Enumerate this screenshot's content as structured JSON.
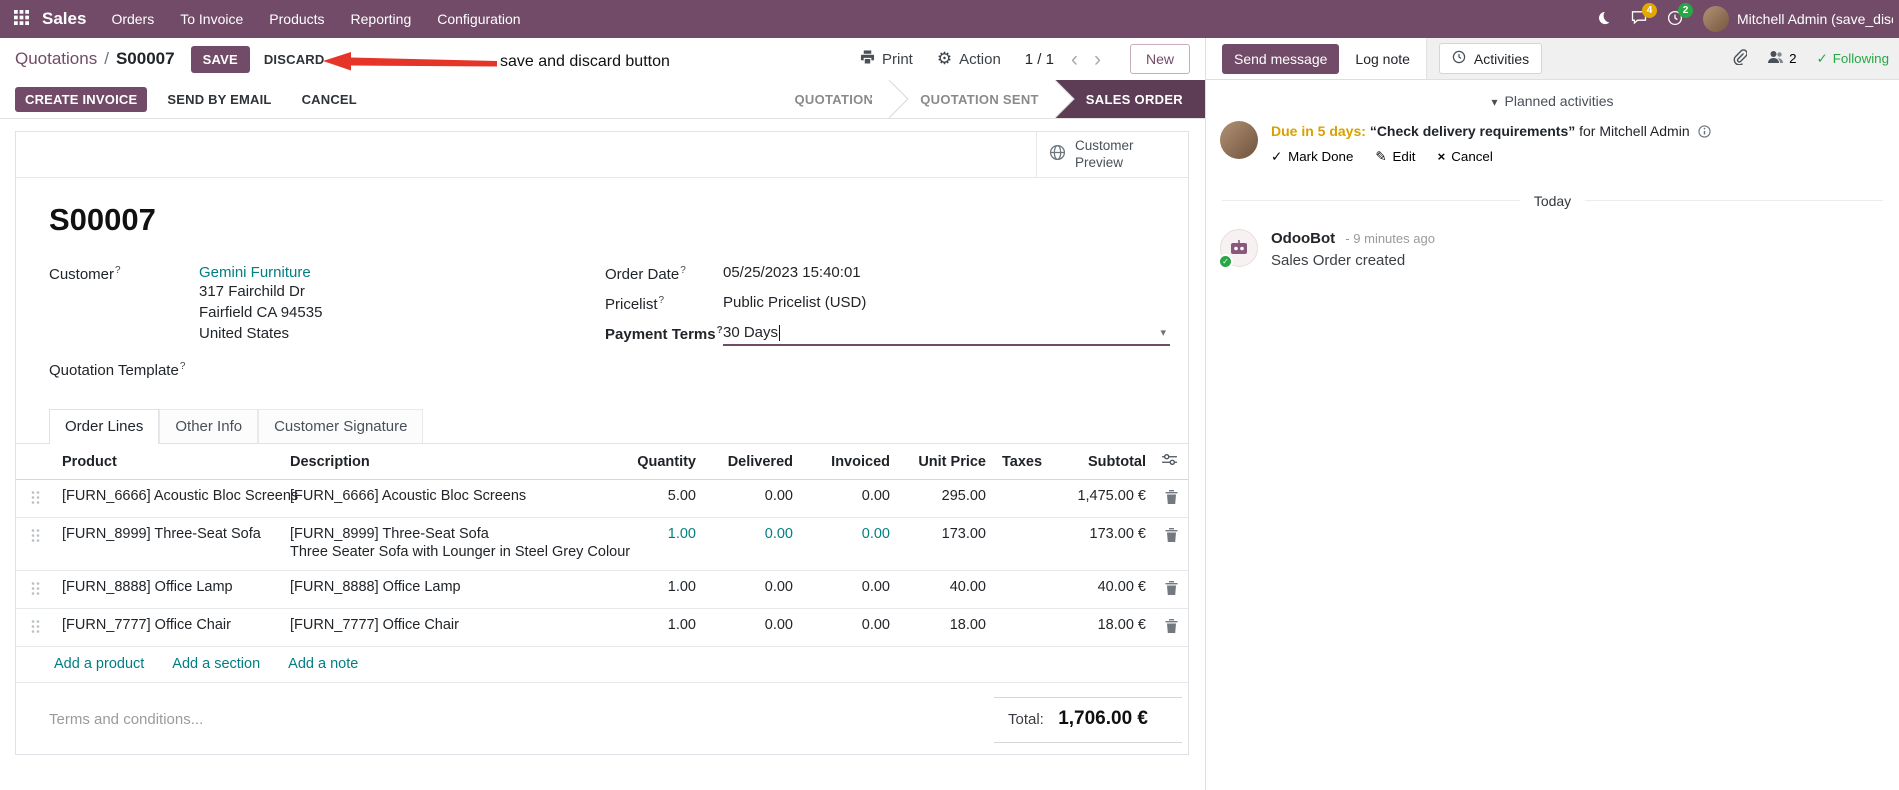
{
  "theme": {
    "primary": "#714B67",
    "statusbar_active": "#5c3d55",
    "link": "#017e84",
    "success": "#28a745",
    "warning": "#e4a900",
    "annotation_red": "#e53528"
  },
  "nav": {
    "app_name": "Sales",
    "menus": [
      "Orders",
      "To Invoice",
      "Products",
      "Reporting",
      "Configuration"
    ],
    "message_badge": "4",
    "activity_badge": "2",
    "user_name": "Mitchell Admin (save_discar"
  },
  "control_panel": {
    "breadcrumb_parent": "Quotations",
    "breadcrumb_separator": "/",
    "breadcrumb_current": "S00007",
    "save_label": "SAVE",
    "discard_label": "DISCARD",
    "print_label": "Print",
    "action_label": "Action",
    "pager_value": "1 / 1",
    "new_label": "New"
  },
  "annotation": {
    "text": "save and discard button"
  },
  "action_buttons": {
    "create_invoice": "CREATE INVOICE",
    "send_by_email": "SEND BY EMAIL",
    "cancel": "CANCEL"
  },
  "statusbar": {
    "steps": [
      {
        "label": "QUOTATION"
      },
      {
        "label": "QUOTATION SENT"
      },
      {
        "label": "SALES ORDER"
      }
    ]
  },
  "sheet": {
    "customer_preview_label": "Customer Preview",
    "title": "S00007",
    "help_marker": "?",
    "customer_label": "Customer",
    "customer_value": "Gemini Furniture",
    "address_line1": "317 Fairchild Dr",
    "address_line2": "Fairfield CA 94535",
    "address_line3": "United States",
    "quotation_template_label": "Quotation Template",
    "order_date_label": "Order Date",
    "order_date_value": "05/25/2023 15:40:01",
    "pricelist_label": "Pricelist",
    "pricelist_value": "Public Pricelist (USD)",
    "payment_terms_label": "Payment Terms",
    "payment_terms_value": "30 Days"
  },
  "tabs": [
    {
      "label": "Order Lines"
    },
    {
      "label": "Other Info"
    },
    {
      "label": "Customer Signature"
    }
  ],
  "order_lines": {
    "headers": {
      "product": "Product",
      "description": "Description",
      "quantity": "Quantity",
      "delivered": "Delivered",
      "invoiced": "Invoiced",
      "unit_price": "Unit Price",
      "taxes": "Taxes",
      "subtotal": "Subtotal"
    },
    "rows": [
      {
        "product": "[FURN_6666] Acoustic Bloc Screens",
        "description": "[FURN_6666] Acoustic Bloc Screens",
        "quantity": "5.00",
        "delivered": "0.00",
        "invoiced": "0.00",
        "unit_price": "295.00",
        "taxes": "",
        "subtotal": "1,475.00 €"
      },
      {
        "product": "[FURN_8999] Three-Seat Sofa",
        "description": "[FURN_8999] Three-Seat Sofa",
        "description_line2": "Three Seater Sofa with Lounger in Steel Grey Colour",
        "quantity": "1.00",
        "delivered": "0.00",
        "invoiced": "0.00",
        "unit_price": "173.00",
        "taxes": "",
        "subtotal": "173.00 €"
      },
      {
        "product": "[FURN_8888] Office Lamp",
        "description": "[FURN_8888] Office Lamp",
        "quantity": "1.00",
        "delivered": "0.00",
        "invoiced": "0.00",
        "unit_price": "40.00",
        "taxes": "",
        "subtotal": "40.00 €"
      },
      {
        "product": "[FURN_7777] Office Chair",
        "description": "[FURN_7777] Office Chair",
        "quantity": "1.00",
        "delivered": "0.00",
        "invoiced": "0.00",
        "unit_price": "18.00",
        "taxes": "",
        "subtotal": "18.00 €"
      }
    ],
    "add_product": "Add a product",
    "add_section": "Add a section",
    "add_note": "Add a note",
    "terms_placeholder": "Terms and conditions...",
    "total_label": "Total:",
    "total_value": "1,706.00 €"
  },
  "chatter": {
    "send_message": "Send message",
    "log_note": "Log note",
    "activities_tab": "Activities",
    "followers_count": "2",
    "following_label": "Following",
    "planned_header": "Planned activities",
    "activity": {
      "due": "Due in 5 days:",
      "title": "“Check delivery requirements”",
      "assignee": "for Mitchell Admin",
      "mark_done": "Mark Done",
      "edit": "Edit",
      "cancel": "Cancel"
    },
    "date_separator": "Today",
    "message": {
      "author": "OdooBot",
      "time": "- 9 minutes ago",
      "body": "Sales Order created"
    }
  }
}
